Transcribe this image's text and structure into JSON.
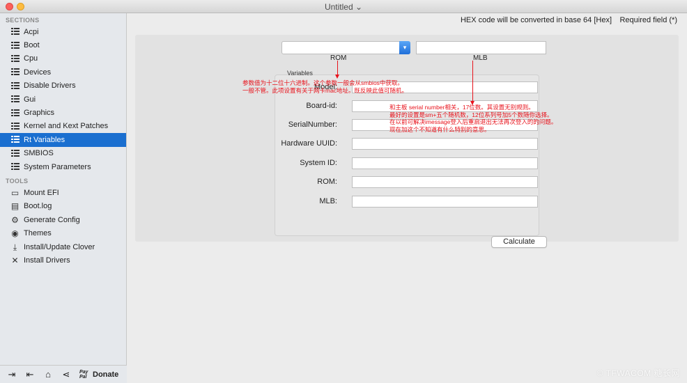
{
  "window": {
    "title": "Untitled ⌄"
  },
  "sidebar": {
    "sections_label": "SECTIONS",
    "sections": [
      {
        "label": "Acpi",
        "icon": "list-icon"
      },
      {
        "label": "Boot",
        "icon": "list-icon"
      },
      {
        "label": "Cpu",
        "icon": "list-icon"
      },
      {
        "label": "Devices",
        "icon": "list-icon"
      },
      {
        "label": "Disable Drivers",
        "icon": "list-icon"
      },
      {
        "label": "Gui",
        "icon": "list-icon"
      },
      {
        "label": "Graphics",
        "icon": "list-icon"
      },
      {
        "label": "Kernel and Kext Patches",
        "icon": "list-icon"
      },
      {
        "label": "Rt Variables",
        "icon": "list-icon",
        "active": true
      },
      {
        "label": "SMBIOS",
        "icon": "list-icon"
      },
      {
        "label": "System Parameters",
        "icon": "list-icon"
      }
    ],
    "tools_label": "TOOLS",
    "tools": [
      {
        "label": "Mount EFI",
        "icon": "disk-icon"
      },
      {
        "label": "Boot.log",
        "icon": "document-icon"
      },
      {
        "label": "Generate Config",
        "icon": "gear-icon"
      },
      {
        "label": "Themes",
        "icon": "eye-icon"
      },
      {
        "label": "Install/Update Clover",
        "icon": "download-icon"
      },
      {
        "label": "Install Drivers",
        "icon": "tools-icon"
      }
    ],
    "bottom": {
      "paypal_line1": "Pay",
      "paypal_line2": "Pal",
      "donate": "Donate"
    }
  },
  "main": {
    "hex_note": "HEX code will be converted in base 64 [Hex]",
    "required_note": "Required field (*)",
    "rom_label": "ROM",
    "mlb_label": "MLB",
    "variables_title": "Variables",
    "fields": [
      {
        "label": "Model:",
        "value": ""
      },
      {
        "label": "Board-id:",
        "value": ""
      },
      {
        "label": "SerialNumber:",
        "value": ""
      },
      {
        "label": "Hardware UUID:",
        "value": ""
      },
      {
        "label": "System ID:",
        "value": ""
      },
      {
        "label": "ROM:",
        "value": ""
      },
      {
        "label": "MLB:",
        "value": ""
      }
    ],
    "calculate": "Calculate"
  },
  "annotations": {
    "rom_note": [
      "参数值为十二位十六进制。这个参数一般会从smbios中获取。",
      "一般不管。此项设置有关于网卡mac地址。既反映此值可随机。"
    ],
    "mlb_note": [
      "和主板 serial number相关，17位数。其设置无别规则。",
      "最好的设置是sm+五个随机数，12位系列号加5个数随你选择。",
      "在以前可解决imessage登入后重启退出无法再次登入的的问题。",
      "现在加这个不知道有什么特别的意思。"
    ],
    "color": "#e8121b"
  },
  "watermark": "© TFWACOM 糖长网"
}
